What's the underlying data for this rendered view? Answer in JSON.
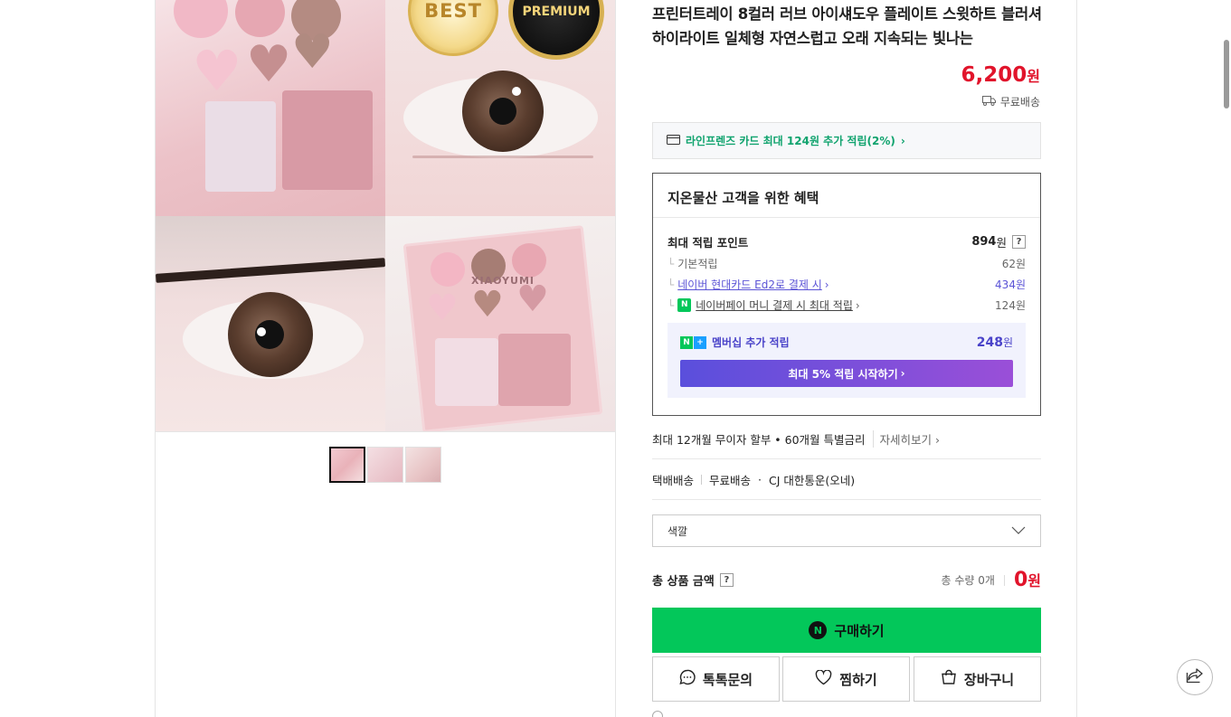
{
  "product": {
    "title": "프린터트레이 8컬러 러브 아이섀도우 플레이트 스윗하트 블러셔 하이라이트 일체형 자연스럽고 오래 지속되는 빛나는",
    "price": "6,200",
    "price_unit": "원",
    "shipping_badge": "무료배송",
    "image_badges": {
      "best": "BEST",
      "premium": "PREMIUM"
    },
    "image_text": "XIAOYUMI",
    "thumbnail_count": 3
  },
  "card_promo": {
    "text": "라인프렌즈 카드 최대 124원 추가 적립(2%)",
    "icon": "card-icon"
  },
  "benefits": {
    "heading": "지온물산 고객을 위한 혜택",
    "max_points_label": "최대 적립 포인트",
    "max_points_value": "894",
    "unit": "원",
    "help": "?",
    "items": [
      {
        "label": "기본적립",
        "value": "62원"
      },
      {
        "label": "네이버 현대카드 Ed2로 결제 시",
        "value": "434원"
      },
      {
        "label": "네이버페이 머니 결제 시 최대 적립",
        "value": "124원"
      }
    ],
    "membership": {
      "label": "멤버십 추가 적립",
      "points": "248",
      "unit": "원",
      "button": "최대 5% 적립 시작하기"
    }
  },
  "installment": {
    "text": "최대 12개월 무이자 할부 • 60개월 특별금리",
    "more": "자세히보기"
  },
  "delivery": {
    "label": "택배배송",
    "fee": "무료배송",
    "dot": "·",
    "carrier": "CJ 대한통운(오네)"
  },
  "option_select": {
    "placeholder": "색깔"
  },
  "total": {
    "label": "총 상품 금액",
    "help": "?",
    "quantity": "총 수량 0개",
    "amount": "0",
    "unit": "원"
  },
  "actions": {
    "buy": "구매하기",
    "buy_logo": "N",
    "talk": "톡톡문의",
    "wish": "찜하기",
    "cart": "장바구니"
  },
  "colors": {
    "accent_green": "#03c75a",
    "price_red": "#e1142b",
    "membership_purple": "#4a43c9"
  }
}
